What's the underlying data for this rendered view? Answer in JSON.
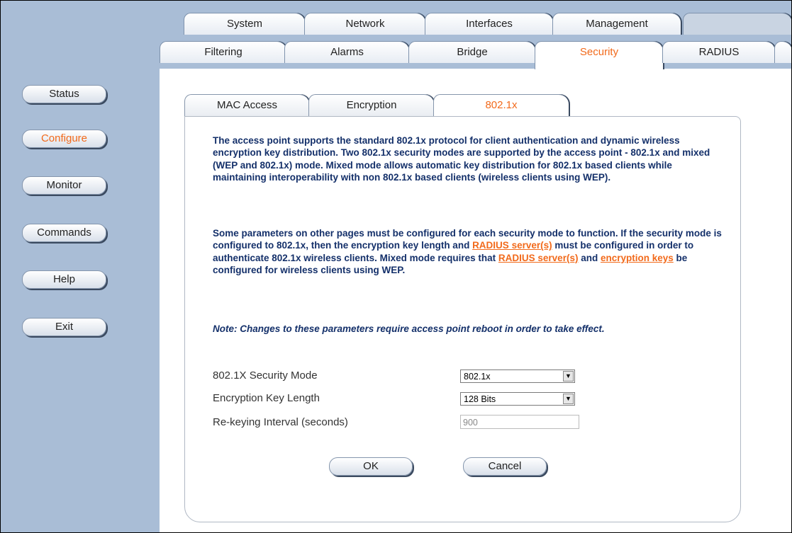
{
  "main_tabs": [
    "System",
    "Network",
    "Interfaces",
    "Management"
  ],
  "sub_tabs": [
    "Filtering",
    "Alarms",
    "Bridge",
    "Security",
    "RADIUS"
  ],
  "security_tabs": [
    "MAC Access",
    "Encryption",
    "802.1x"
  ],
  "nav": [
    "Status",
    "Configure",
    "Monitor",
    "Commands",
    "Help",
    "Exit"
  ],
  "content": {
    "p1": "The access point supports the standard 802.1x protocol for client authentication and dynamic wireless encryption key distribution. Two 802.1x security modes are supported by the access point - 802.1x and mixed (WEP and 802.1x) mode. Mixed mode allows automatic key distribution for 802.1x based clients while maintaining interoperability with non 802.1x based clients (wireless clients using WEP).",
    "p2a": "Some parameters on other pages must be configured for each security mode to function. If the security mode is configured to 802.1x, then the encryption key length and ",
    "link_radius": "RADIUS server(s)",
    "p2b": " must be configured in order to authenticate 802.1x wireless clients. Mixed mode requires that ",
    "p2c": " and ",
    "link_keys": "encryption keys",
    "p2d": " be configured for wireless clients using WEP.",
    "note": "Note: Changes to these parameters require access point reboot in order to take effect."
  },
  "form": {
    "mode_label": "802.1X Security Mode",
    "mode_value": "802.1x",
    "keylen_label": "Encryption Key Length",
    "keylen_value": "128 Bits",
    "rekey_label": "Re-keying Interval (seconds)",
    "rekey_value": "900"
  },
  "buttons": {
    "ok": "OK",
    "cancel": "Cancel"
  },
  "colors": {
    "accent": "#f26a1b",
    "text": "#14306a",
    "sidebar": "#a9bdd6"
  }
}
